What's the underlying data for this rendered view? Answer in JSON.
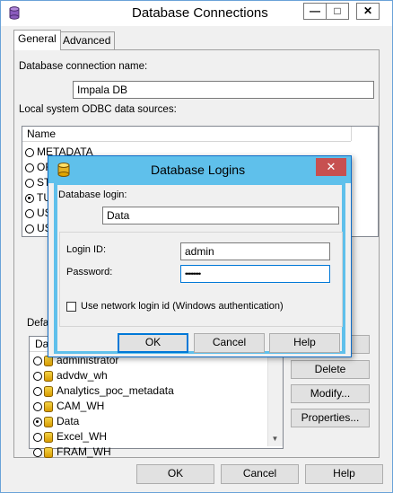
{
  "window": {
    "title": "Database Connections",
    "minimize_glyph": "—",
    "maximize_glyph": "□",
    "close_glyph": "✕",
    "icon": "database-icon"
  },
  "tabs": [
    {
      "label": "General",
      "active": true
    },
    {
      "label": "Advanced",
      "active": false
    }
  ],
  "general": {
    "connection_name_label": "Database connection name:",
    "connection_name_value": "Impala DB",
    "odbc_label": "Local system ODBC data sources:",
    "odbc_column_header": "Name",
    "odbc_sources": [
      "METADATA",
      "OF",
      "ST",
      "TU",
      "US",
      "US"
    ],
    "odbc_selected_index": 3,
    "default_label": "Defa",
    "default_column_header": "Dat",
    "default_items": [
      "administrator",
      "advdw_wh",
      "Analytics_poc_metadata",
      "CAM_WH",
      "Data",
      "Excel_WH",
      "FRAM_WH"
    ],
    "default_selected_index": 4,
    "buttons": {
      "delete": "Delete",
      "modify": "Modify...",
      "properties": "Properties..."
    }
  },
  "footer": {
    "ok": "OK",
    "cancel": "Cancel",
    "help": "Help"
  },
  "login_dialog": {
    "title": "Database Logins",
    "icon": "database-icon",
    "close_glyph": "✕",
    "database_login_label": "Database login:",
    "database_login_value": "Data",
    "login_id_label": "Login ID:",
    "login_id_value": "admin",
    "password_label": "Password:",
    "password_value": "••••••••",
    "network_login_label": "Use network login id (Windows authentication)",
    "network_login_checked": false,
    "ok": "OK",
    "cancel": "Cancel",
    "help": "Help"
  },
  "colors": {
    "dialog_title": "#5fc0eb",
    "focus": "#0078d7",
    "window_border": "#6aa2d8"
  }
}
